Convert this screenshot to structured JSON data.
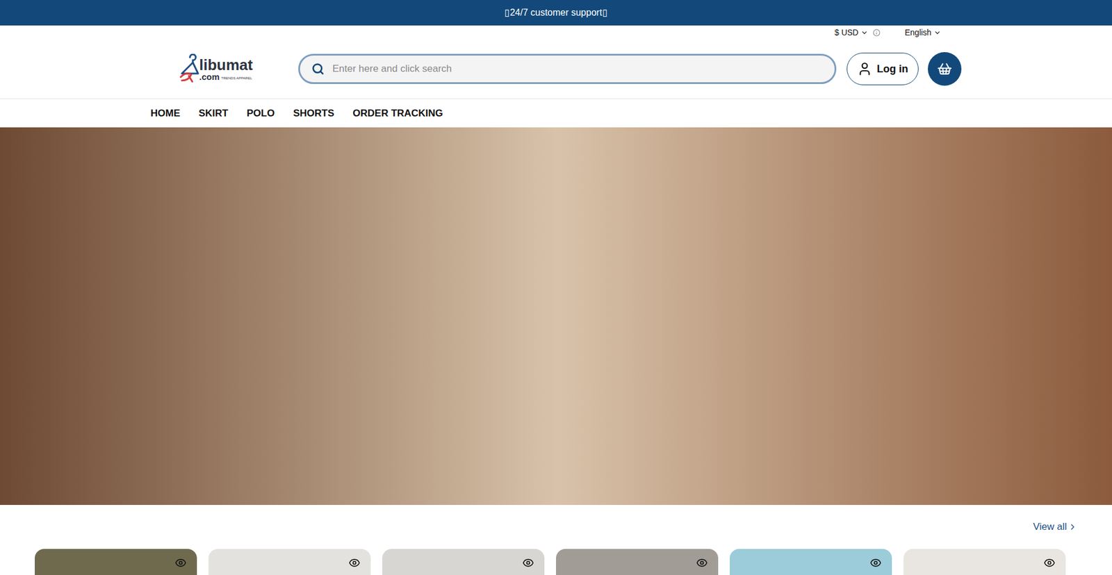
{
  "announcement": {
    "text": "▯24/7 customer support▯"
  },
  "utility_bar": {
    "currency": "$ USD",
    "language": "English"
  },
  "logo": {
    "name": "libumat",
    "suffix": ".com",
    "tagline": "TRENDS APPAREL"
  },
  "search": {
    "placeholder": "Enter here and click search"
  },
  "login": {
    "label": "Log in"
  },
  "nav": {
    "items": [
      {
        "label": "HOME"
      },
      {
        "label": "SKIRT"
      },
      {
        "label": "POLO"
      },
      {
        "label": "SHORTS"
      },
      {
        "label": "ORDER TRACKING"
      }
    ]
  },
  "products_section": {
    "view_all": "View all"
  },
  "products": [
    {
      "color": "#6f6a4e"
    },
    {
      "color": "#e4e2df"
    },
    {
      "color": "#d8d6d2"
    },
    {
      "color": "#a19d96"
    },
    {
      "color": "#9ccbd9"
    },
    {
      "color": "#e9e6e1"
    }
  ]
}
